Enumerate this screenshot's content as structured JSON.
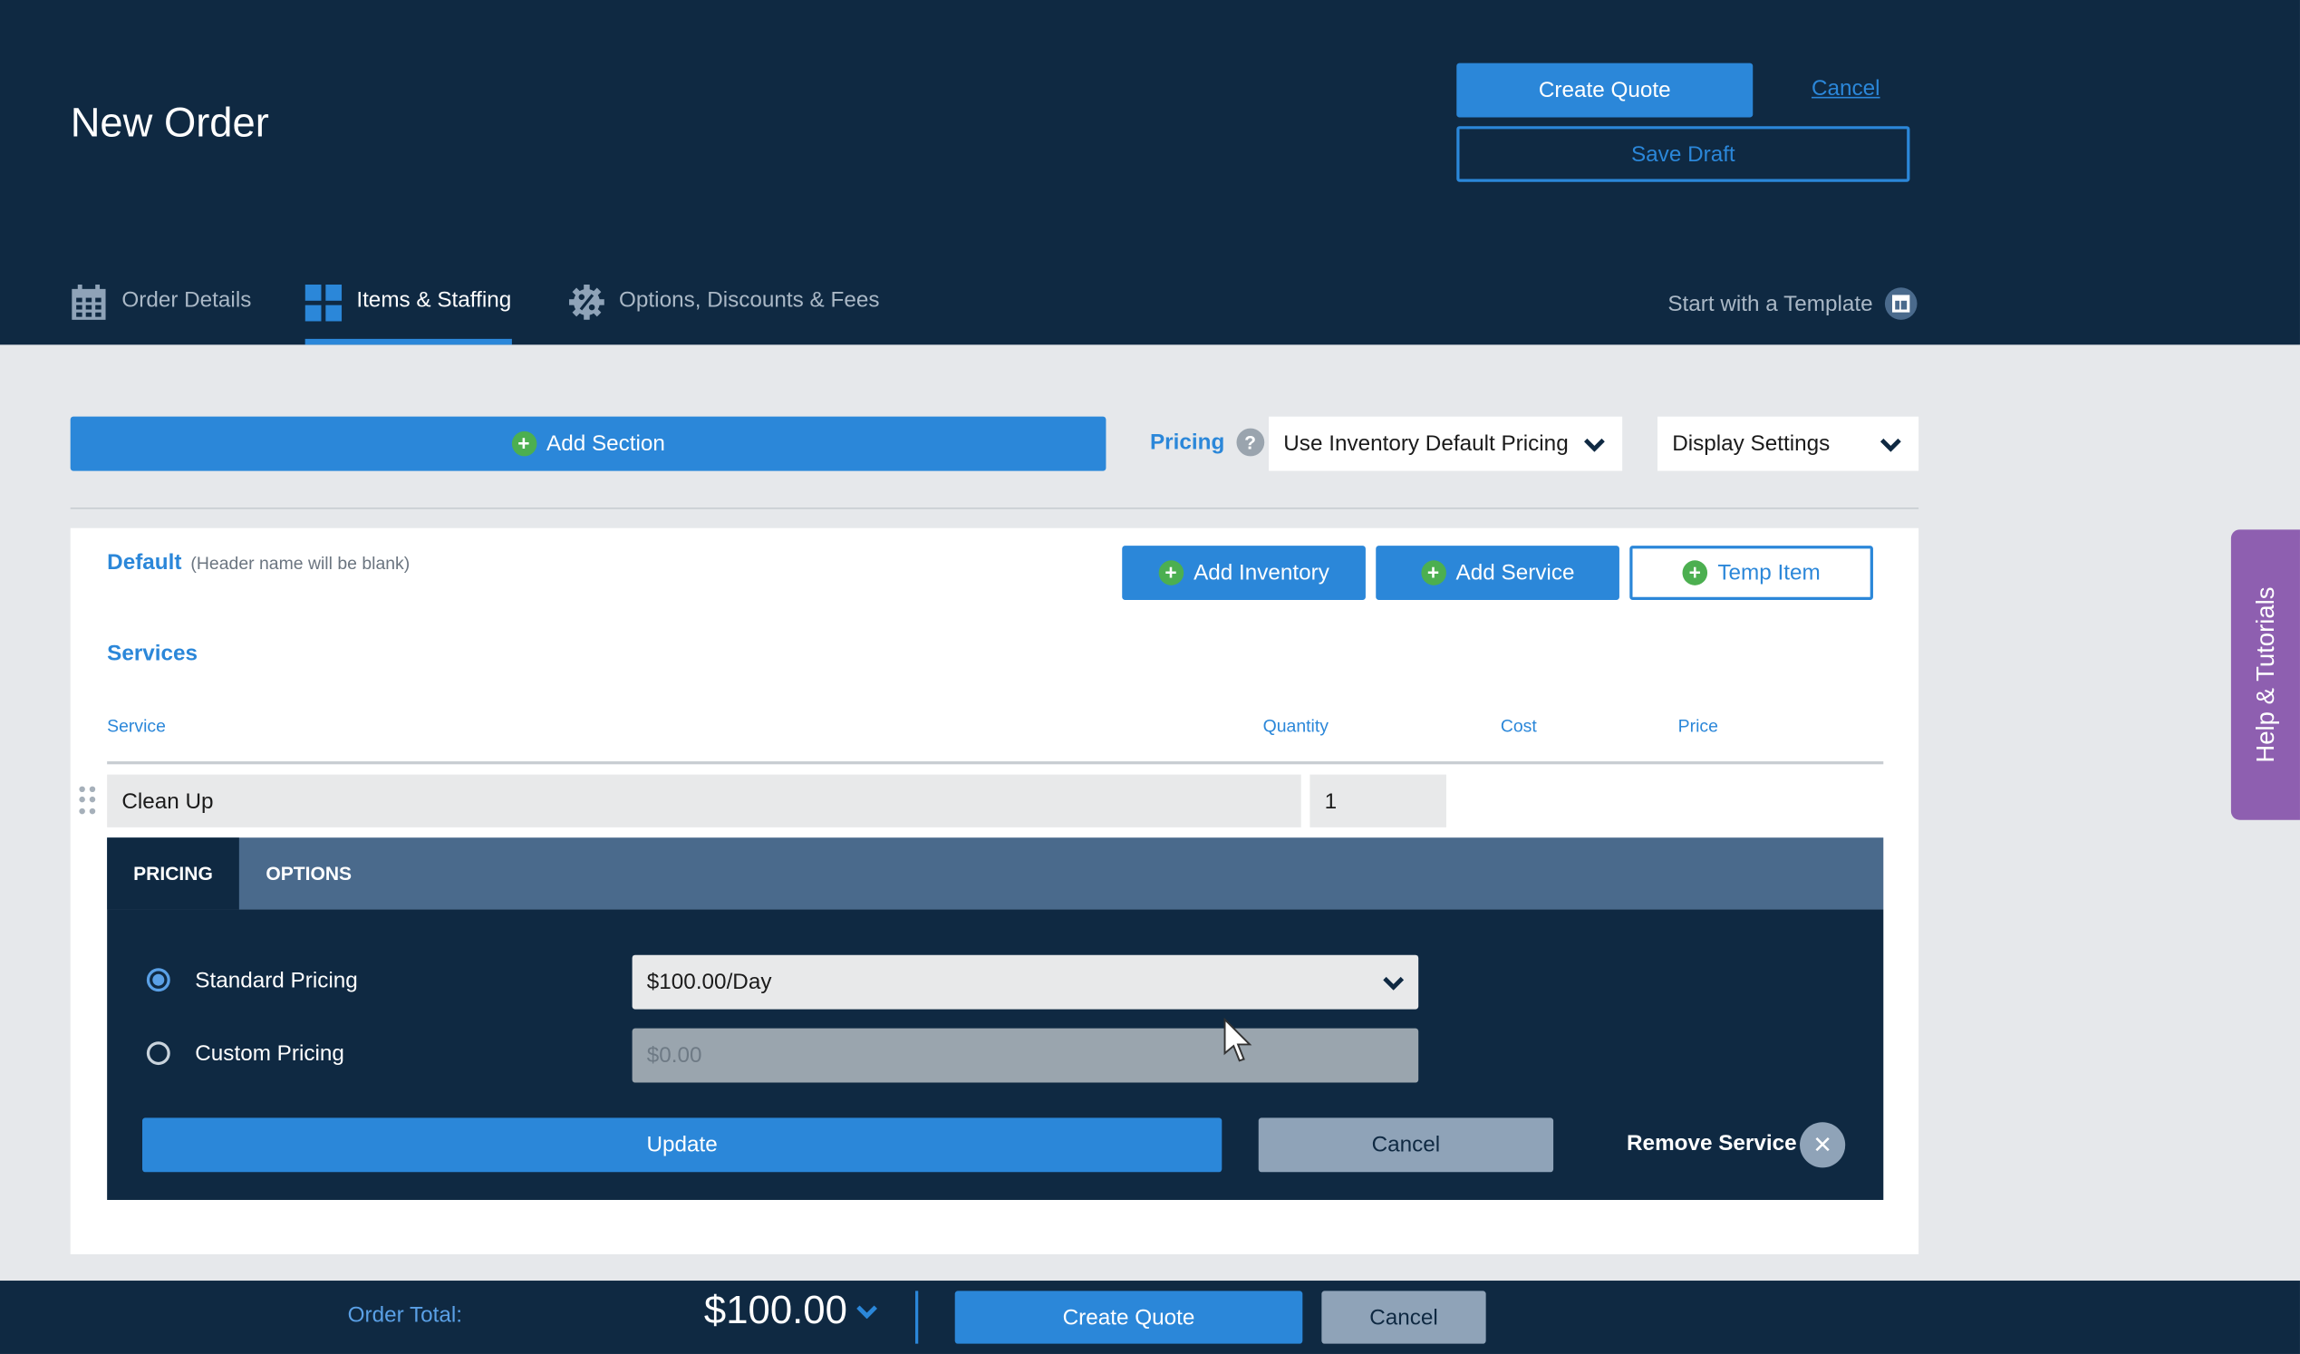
{
  "header": {
    "title": "New Order",
    "create_quote_label": "Create Quote",
    "cancel_label": "Cancel",
    "save_draft_label": "Save Draft",
    "template_link_label": "Start with a Template"
  },
  "tabs": [
    {
      "label": "Order Details",
      "icon": "calendar-icon",
      "active": false
    },
    {
      "label": "Items & Staffing",
      "icon": "grid-icon",
      "active": true
    },
    {
      "label": "Options, Discounts & Fees",
      "icon": "percent-gear-icon",
      "active": false
    }
  ],
  "toolbar": {
    "add_section_label": "Add Section",
    "pricing_label": "Pricing",
    "pricing_help": "?",
    "pricing_select_value": "Use Inventory Default Pricing",
    "display_settings_label": "Display Settings"
  },
  "section": {
    "name": "Default",
    "note": "(Header name will be blank)",
    "add_inventory_label": "Add Inventory",
    "add_service_label": "Add Service",
    "temp_item_label": "Temp Item"
  },
  "services": {
    "title": "Services",
    "columns": [
      "Service",
      "Quantity",
      "Cost",
      "Price"
    ],
    "row": {
      "name": "Clean Up",
      "quantity": "1"
    }
  },
  "panel": {
    "tabs": [
      "PRICING",
      "OPTIONS"
    ],
    "standard_label": "Standard Pricing",
    "standard_value": "$100.00/Day",
    "custom_label": "Custom Pricing",
    "custom_placeholder": "$0.00",
    "update_label": "Update",
    "cancel_label": "Cancel",
    "remove_label": "Remove Service"
  },
  "footer": {
    "total_label": "Order Total:",
    "total_value": "$100.00",
    "create_quote_label": "Create Quote",
    "cancel_label": "Cancel"
  },
  "help_tab_label": "Help & Tutorials",
  "colors": {
    "header_bg": "#0f2942",
    "accent": "#2b87d9",
    "add_green": "#4caf50",
    "help_purple": "#8e5fb0"
  }
}
